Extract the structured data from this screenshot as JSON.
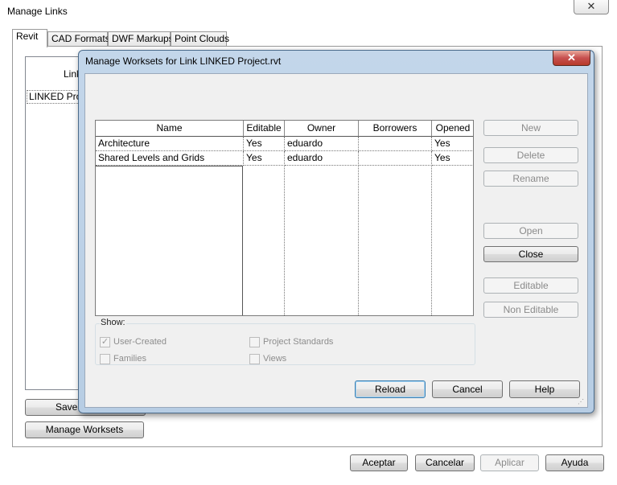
{
  "outer_window": {
    "title": "Manage Links",
    "close_glyph": "✕",
    "tabs": [
      "Revit",
      "CAD Formats",
      "DWF Markups",
      "Point Clouds"
    ],
    "list_header": "Link",
    "list_row": "LINKED Proj",
    "save_label": "Save",
    "manage_worksets_label": "Manage Worksets",
    "footer": {
      "ok": "Aceptar",
      "cancel": "Cancelar",
      "apply": "Aplicar",
      "help": "Ayuda"
    }
  },
  "dialog": {
    "title": "Manage Worksets for Link LINKED Project.rvt",
    "close_glyph": "✕",
    "columns": [
      "Name",
      "Editable",
      "Owner",
      "Borrowers",
      "Opened"
    ],
    "rows": [
      {
        "name": "Architecture",
        "editable": "Yes",
        "owner": "eduardo",
        "borrowers": "",
        "opened": "Yes"
      },
      {
        "name": "Shared Levels and Grids",
        "editable": "Yes",
        "owner": "eduardo",
        "borrowers": "",
        "opened": "Yes"
      }
    ],
    "side_buttons": {
      "new": "New",
      "delete": "Delete",
      "rename": "Rename",
      "open": "Open",
      "close": "Close",
      "editable": "Editable",
      "non_editable": "Non Editable"
    },
    "show": {
      "label": "Show:",
      "user_created": "User-Created",
      "user_created_checked": true,
      "families": "Families",
      "families_checked": false,
      "project_standards": "Project Standards",
      "project_standards_checked": false,
      "views": "Views",
      "views_checked": false
    },
    "bottom_buttons": {
      "reload": "Reload",
      "cancel": "Cancel",
      "help": "Help"
    }
  },
  "colors": {
    "title_bar": "#b7cde4",
    "close_red": "#c75050",
    "focus_blue": "#3c7fb1"
  },
  "icons": {
    "close": "close-icon",
    "checkbox_checked": "checkmark-icon",
    "resize": "resize-grip-icon"
  }
}
